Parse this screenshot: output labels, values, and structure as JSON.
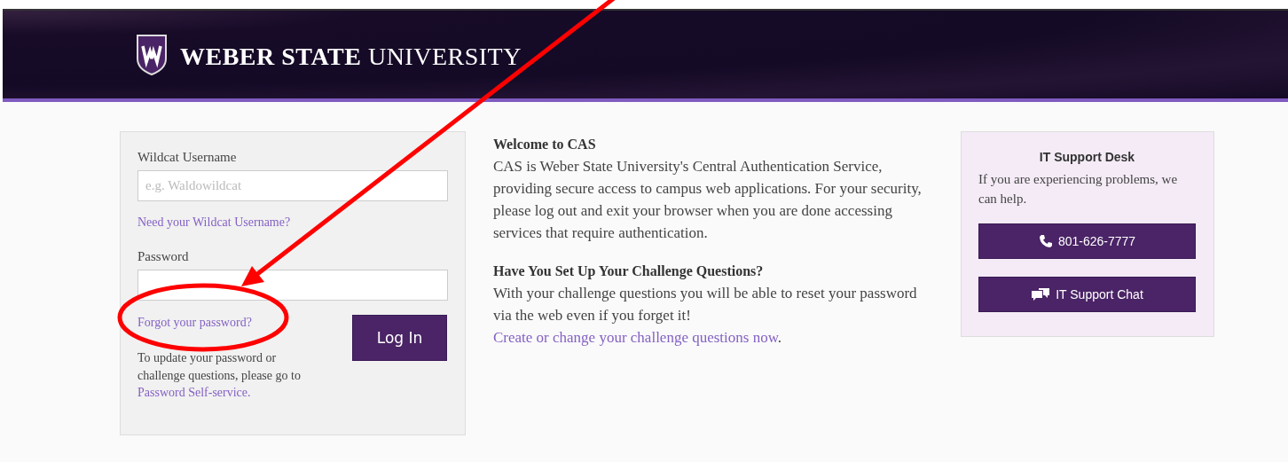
{
  "header": {
    "logo_text": "**WEBER STATE** UNIVERSITY"
  },
  "login": {
    "username_label": "Wildcat Username",
    "username_placeholder": "e.g. Waldowildcat",
    "username_help": "Need your Wildcat Username?",
    "password_label": "Password",
    "forgot_link": "Forgot your password?",
    "login_button": "Log In",
    "update_note": "To update your password or challenge questions, please go to",
    "self_service_link": "Password Self-service."
  },
  "welcome": {
    "title": "Welcome to CAS",
    "body": "CAS is Weber State University's Central Authentication Service, providing secure access to campus web applications. For your security, please log out and exit your browser when you are done accessing services that require authentication.",
    "challenge_title": "Have You Set Up Your Challenge Questions?",
    "challenge_body": "With your challenge questions you will be able to reset your password via the web even if you forget it!",
    "challenge_link": "Create or change your challenge questions now",
    "challenge_end": "."
  },
  "support": {
    "title": "IT Support Desk",
    "body": "If you are experiencing problems, we can help.",
    "buttons": [
      {
        "kind": "phone",
        "label": "801-626-7777"
      },
      {
        "kind": "chat",
        "label": "IT Support Chat"
      }
    ]
  }
}
